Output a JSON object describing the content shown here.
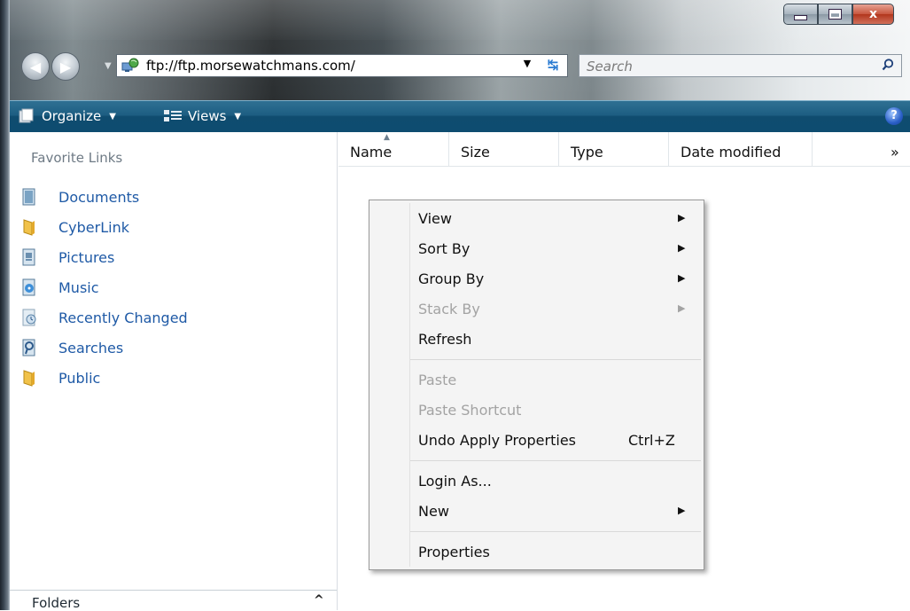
{
  "window": {
    "close_glyph": "x"
  },
  "nav": {
    "address": "ftp://ftp.morsewatchmans.com/",
    "search_placeholder": "Search"
  },
  "commandbar": {
    "organize": "Organize",
    "views": "Views",
    "help": "?"
  },
  "sidebar": {
    "favorites_heading": "Favorite Links",
    "items": [
      {
        "label": "Documents",
        "icon": "documents-icon"
      },
      {
        "label": "CyberLink",
        "icon": "folder-icon"
      },
      {
        "label": "Pictures",
        "icon": "pictures-icon"
      },
      {
        "label": "Music",
        "icon": "music-icon"
      },
      {
        "label": "Recently Changed",
        "icon": "recently-changed-icon"
      },
      {
        "label": "Searches",
        "icon": "searches-icon"
      },
      {
        "label": "Public",
        "icon": "folder-icon"
      }
    ],
    "folders_label": "Folders"
  },
  "columns": {
    "name": "Name",
    "size": "Size",
    "type": "Type",
    "date_modified": "Date modified",
    "more": "»"
  },
  "context_menu": {
    "items": [
      {
        "label": "View",
        "submenu": true,
        "enabled": true
      },
      {
        "label": "Sort By",
        "submenu": true,
        "enabled": true
      },
      {
        "label": "Group By",
        "submenu": true,
        "enabled": true
      },
      {
        "label": "Stack By",
        "submenu": true,
        "enabled": false
      },
      {
        "label": "Refresh",
        "enabled": true
      },
      {
        "label": "Paste",
        "enabled": false
      },
      {
        "label": "Paste Shortcut",
        "enabled": false
      },
      {
        "label": "Undo Apply Properties",
        "shortcut": "Ctrl+Z",
        "enabled": true
      },
      {
        "label": "Login As...",
        "enabled": true
      },
      {
        "label": "New",
        "submenu": true,
        "enabled": true
      },
      {
        "label": "Properties",
        "enabled": true
      }
    ]
  },
  "colors": {
    "commandbar": "#1d5e82",
    "link": "#1f5aa6",
    "disabled_text": "#a3a3a3"
  }
}
